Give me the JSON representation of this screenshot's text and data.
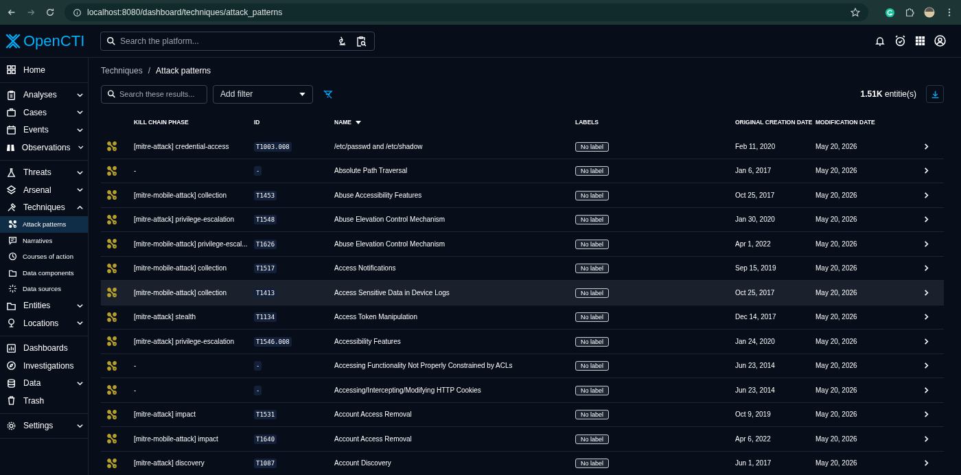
{
  "browser": {
    "url": "localhost:8080/dashboard/techniques/attack_patterns"
  },
  "app": {
    "logo": "OpenCTI",
    "search": {
      "placeholder": "Search the platform..."
    }
  },
  "sidebar": {
    "groups": [
      [
        {
          "label": "Home",
          "selected": false
        }
      ],
      [
        {
          "label": "Analyses",
          "expanded": false,
          "selected": false
        },
        {
          "label": "Cases",
          "expanded": false,
          "selected": false
        },
        {
          "label": "Events",
          "expanded": false,
          "selected": false
        },
        {
          "label": "Observations",
          "expanded": false,
          "selected": false
        }
      ],
      [
        {
          "label": "Threats",
          "expanded": false,
          "selected": false
        },
        {
          "label": "Arsenal",
          "expanded": false,
          "selected": false
        },
        {
          "label": "Techniques",
          "expanded": true,
          "selected": false,
          "children": [
            {
              "label": "Attack patterns",
              "selected": true
            },
            {
              "label": "Narratives",
              "selected": false
            },
            {
              "label": "Courses of action",
              "selected": false
            },
            {
              "label": "Data components",
              "selected": false
            },
            {
              "label": "Data sources",
              "selected": false
            }
          ]
        },
        {
          "label": "Entities",
          "expanded": false,
          "selected": false
        },
        {
          "label": "Locations",
          "expanded": false,
          "selected": false
        }
      ],
      [
        {
          "label": "Dashboards",
          "selected": false
        },
        {
          "label": "Investigations",
          "selected": false
        },
        {
          "label": "Data",
          "expanded": false,
          "selected": false
        },
        {
          "label": "Trash",
          "selected": false
        }
      ],
      [
        {
          "label": "Settings",
          "expanded": false,
          "selected": false
        }
      ]
    ]
  },
  "breadcrumb": {
    "items": [
      "Techniques",
      "Attack patterns"
    ],
    "separator": "/"
  },
  "toolbar": {
    "search": {
      "placeholder": "Search these results..."
    },
    "filter": {
      "placeholder": "Add filter"
    },
    "count": "1.51K",
    "count_unit": "entitie(s)"
  },
  "table": {
    "columns": [
      {
        "label": "KILL CHAIN PHASE",
        "sorted": false
      },
      {
        "label": "ID",
        "sorted": false
      },
      {
        "label": "NAME",
        "sorted": true
      },
      {
        "label": "LABELS",
        "sorted": false
      },
      {
        "label": "ORIGINAL CREATION DATE",
        "sorted": false
      },
      {
        "label": "MODIFICATION DATE",
        "sorted": false
      }
    ],
    "rows": [
      {
        "phase": "[mitre-attack] credential-access",
        "id": "T1003.008",
        "name": "/etc/passwd and /etc/shadow",
        "label": "No label",
        "created": "Feb 11, 2020",
        "modified": "May 20, 2026",
        "highlighted": false
      },
      {
        "phase": "-",
        "id": "-",
        "name": "Absolute Path Traversal",
        "label": "No label",
        "created": "Jan 6, 2017",
        "modified": "May 20, 2026",
        "highlighted": false
      },
      {
        "phase": "[mitre-mobile-attack] collection",
        "id": "T1453",
        "name": "Abuse Accessibility Features",
        "label": "No label",
        "created": "Oct 25, 2017",
        "modified": "May 20, 2026",
        "highlighted": false
      },
      {
        "phase": "[mitre-attack] privilege-escalation",
        "id": "T1548",
        "name": "Abuse Elevation Control Mechanism",
        "label": "No label",
        "created": "Jan 30, 2020",
        "modified": "May 20, 2026",
        "highlighted": false
      },
      {
        "phase": "[mitre-mobile-attack] privilege-escal...",
        "id": "T1626",
        "name": "Abuse Elevation Control Mechanism",
        "label": "No label",
        "created": "Apr 1, 2022",
        "modified": "May 20, 2026",
        "highlighted": false
      },
      {
        "phase": "[mitre-mobile-attack] collection",
        "id": "T1517",
        "name": "Access Notifications",
        "label": "No label",
        "created": "Sep 15, 2019",
        "modified": "May 20, 2026",
        "highlighted": false
      },
      {
        "phase": "[mitre-mobile-attack] collection",
        "id": "T1413",
        "name": "Access Sensitive Data in Device Logs",
        "label": "No label",
        "created": "Oct 25, 2017",
        "modified": "May 20, 2026",
        "highlighted": true
      },
      {
        "phase": "[mitre-attack] stealth",
        "id": "T1134",
        "name": "Access Token Manipulation",
        "label": "No label",
        "created": "Dec 14, 2017",
        "modified": "May 20, 2026",
        "highlighted": false
      },
      {
        "phase": "[mitre-attack] privilege-escalation",
        "id": "T1546.008",
        "name": "Accessibility Features",
        "label": "No label",
        "created": "Jan 24, 2020",
        "modified": "May 20, 2026",
        "highlighted": false
      },
      {
        "phase": "-",
        "id": "-",
        "name": "Accessing Functionality Not Properly Constrained by ACLs",
        "label": "No label",
        "created": "Jun 23, 2014",
        "modified": "May 20, 2026",
        "highlighted": false
      },
      {
        "phase": "-",
        "id": "-",
        "name": "Accessing/Intercepting/Modifying HTTP Cookies",
        "label": "No label",
        "created": "Jun 23, 2014",
        "modified": "May 20, 2026",
        "highlighted": false
      },
      {
        "phase": "[mitre-attack] impact",
        "id": "T1531",
        "name": "Account Access Removal",
        "label": "No label",
        "created": "Oct 9, 2019",
        "modified": "May 20, 2026",
        "highlighted": false
      },
      {
        "phase": "[mitre-mobile-attack] impact",
        "id": "T1640",
        "name": "Account Access Removal",
        "label": "No label",
        "created": "Apr 6, 2022",
        "modified": "May 20, 2026",
        "highlighted": false
      },
      {
        "phase": "[mitre-attack] discovery",
        "id": "T1087",
        "name": "Account Discovery",
        "label": "No label",
        "created": "Jun 1, 2017",
        "modified": "May 20, 2026",
        "highlighted": false
      }
    ]
  }
}
